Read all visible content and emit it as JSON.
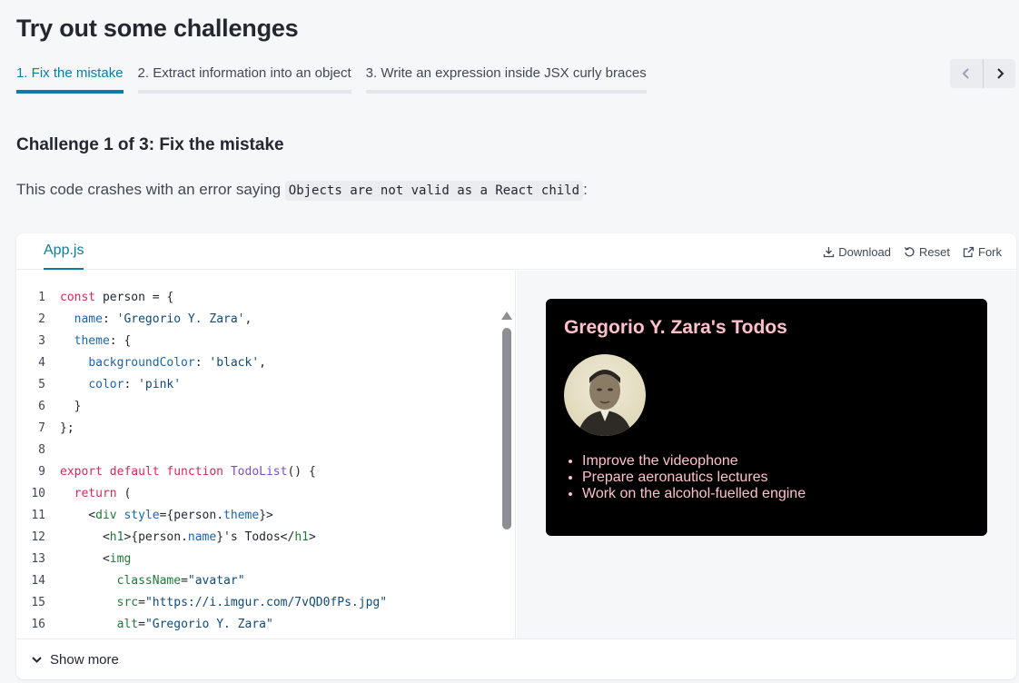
{
  "page": {
    "title": "Try out some challenges"
  },
  "tabs": [
    {
      "label": "1. Fix the mistake",
      "active": true
    },
    {
      "label": "2. Extract information into an object",
      "active": false
    },
    {
      "label": "3. Write an expression inside JSX curly braces",
      "active": false
    }
  ],
  "nav": {
    "prev_icon": "chevron-left-icon",
    "next_icon": "chevron-right-icon"
  },
  "challenge": {
    "heading_prefix": "Challenge 1 of 3:",
    "heading_title": "Fix the mistake",
    "text_before": "This code crashes with an error saying",
    "inline_code": "Objects are not valid as a React child",
    "text_after": ":"
  },
  "sandbox": {
    "file_tab": "App.js",
    "actions": {
      "download": "Download",
      "reset": "Reset",
      "fork": "Fork"
    },
    "footer_label": "Show more",
    "code_lines": [
      {
        "n": "1",
        "text": "const person = {"
      },
      {
        "n": "2",
        "text": "  name: 'Gregorio Y. Zara',"
      },
      {
        "n": "3",
        "text": "  theme: {"
      },
      {
        "n": "4",
        "text": "    backgroundColor: 'black',"
      },
      {
        "n": "5",
        "text": "    color: 'pink'"
      },
      {
        "n": "6",
        "text": "  }"
      },
      {
        "n": "7",
        "text": "};"
      },
      {
        "n": "8",
        "text": ""
      },
      {
        "n": "9",
        "text": "export default function TodoList() {"
      },
      {
        "n": "10",
        "text": "  return ("
      },
      {
        "n": "11",
        "text": "    <div style={person.theme}>"
      },
      {
        "n": "12",
        "text": "      <h1>{person.name}'s Todos</h1>"
      },
      {
        "n": "13",
        "text": "      <img"
      },
      {
        "n": "14",
        "text": "        className=\"avatar\""
      },
      {
        "n": "15",
        "text": "        src=\"https://i.imgur.com/7vQD0fPs.jpg\""
      },
      {
        "n": "16",
        "text": "        alt=\"Gregorio Y. Zara\""
      }
    ]
  },
  "preview": {
    "title": "Gregorio Y. Zara's Todos",
    "todos": [
      "Improve the videophone",
      "Prepare aeronautics lectures",
      "Work on the alcohol-fuelled engine"
    ]
  },
  "colors": {
    "accent": "#087ea4",
    "preview_bg": "#000000",
    "preview_text": "pink"
  }
}
